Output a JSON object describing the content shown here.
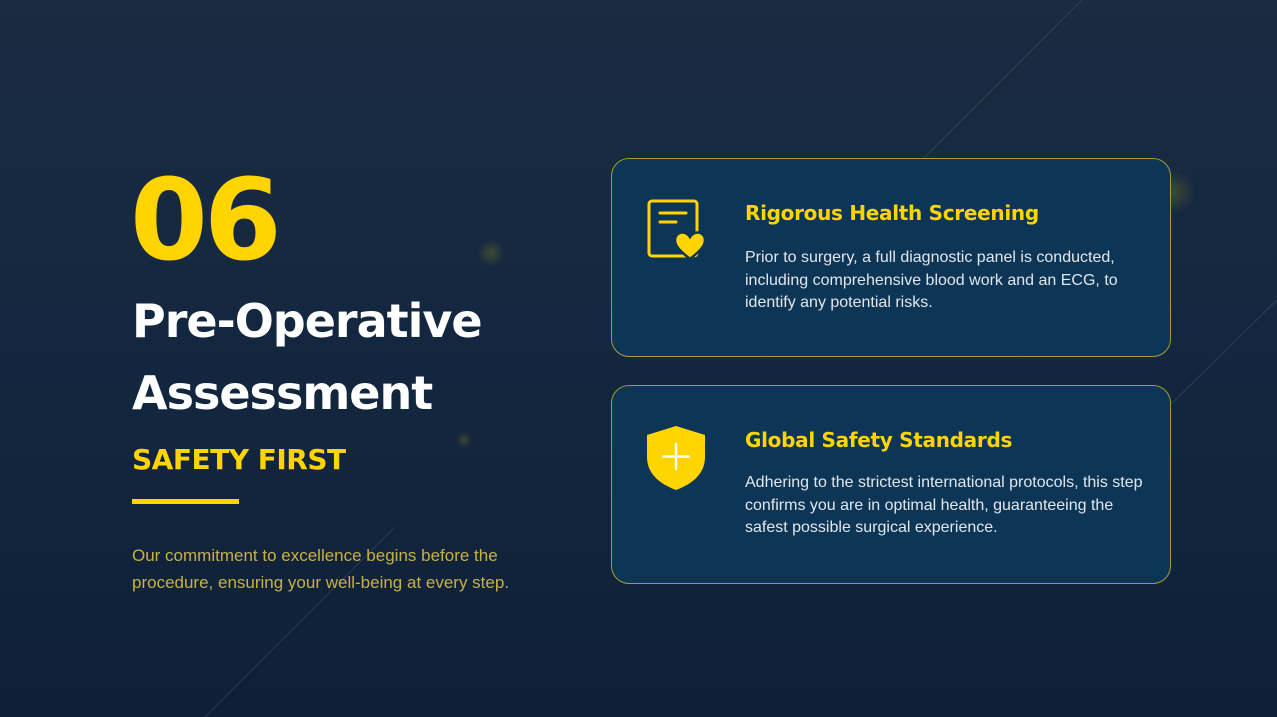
{
  "slide": {
    "number": "06",
    "title": "Pre-Operative\nAssessment",
    "subtitle": "SAFETY FIRST",
    "intro": "Our commitment to excellence begins before the procedure, ensuring your well-being at every step."
  },
  "cards": [
    {
      "icon": "medical-report-heart-icon",
      "title": "Rigorous Health Screening",
      "text": "Prior to surgery, a full diagnostic panel is conducted, including comprehensive blood work and an ECG, to identify any potential risks."
    },
    {
      "icon": "shield-plus-icon",
      "title": "Global Safety Standards",
      "text": "Adhering to the strictest international protocols, this step confirms you are in optimal health, guaranteeing the safest possible surgical experience."
    }
  ],
  "colors": {
    "accent": "#ffd400",
    "background": "#132840",
    "card_background": "#0d3556",
    "card_border": "#a89a33",
    "intro_text": "#c7b146"
  }
}
